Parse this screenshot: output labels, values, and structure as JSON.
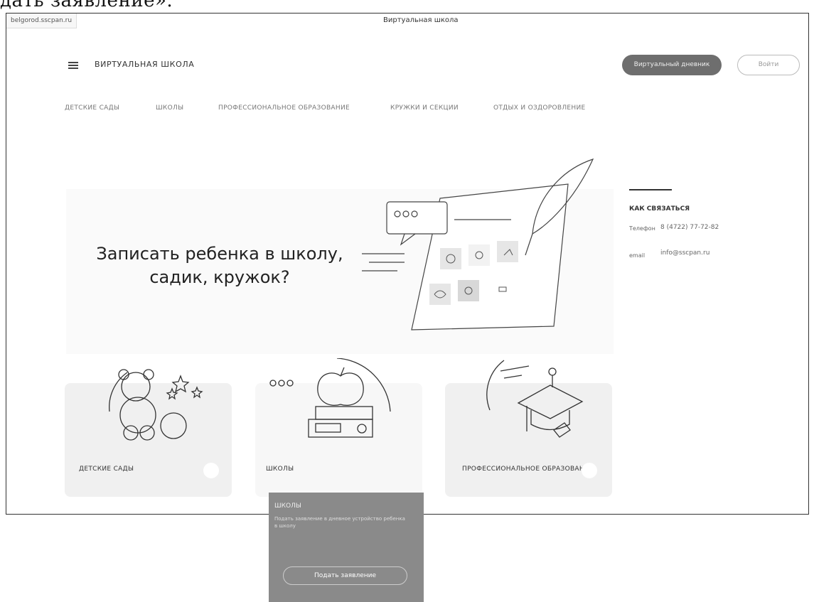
{
  "caption": "дать заявление».",
  "browser": {
    "url": "belgorod.sscpan.ru",
    "tab_title": "Виртуальная школа"
  },
  "header": {
    "logo_text": "ВИРТУАЛЬНАЯ ШКОЛА",
    "diary_button": "Виртуальный дневник",
    "login_button": "Войти"
  },
  "nav": {
    "items": [
      {
        "label": "ДЕТСКИЕ САДЫ"
      },
      {
        "label": "ШКОЛЫ"
      },
      {
        "label": "ПРОФЕССИОНАЛЬНОЕ ОБРАЗОВАНИЕ"
      },
      {
        "label": "КРУЖКИ И СЕКЦИИ"
      },
      {
        "label": "ОТДЫХ И ОЗДОРОВЛЕНИЕ"
      }
    ]
  },
  "hero": {
    "title": "Записать ребенка в школу, садик, кружок?"
  },
  "contacts": {
    "heading": "КАК СВЯЗАТЬСЯ",
    "phone_label": "Телефон",
    "phone_value": "8 (4722) 77-72-82",
    "email_label": "email",
    "email_value": "info@sscpan.ru"
  },
  "cards": [
    {
      "label": "ДЕТСКИЕ САДЫ"
    },
    {
      "label": "ШКОЛЫ"
    },
    {
      "label": "ПРОФЕССИОНАЛЬНОЕ ОБРАЗОВАНИЕ"
    }
  ],
  "popup": {
    "title": "ШКОЛЫ",
    "description": "Подать заявление в дневное устройство ребенка в школу",
    "button": "Подать заявление"
  },
  "colors": {
    "dark_button": "#6e6e6e",
    "card_bg": "#f0f0f0",
    "popup_bg": "#8a8a8a"
  }
}
